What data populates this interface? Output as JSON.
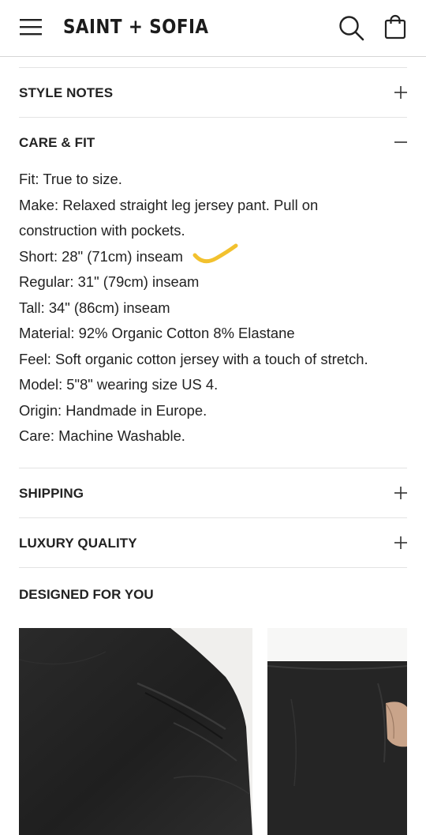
{
  "header": {
    "brand": "SAINT + SOFIA",
    "menu_icon": "hamburger-menu-icon",
    "search_icon": "search-icon",
    "bag_icon": "shopping-bag-icon"
  },
  "accordions": {
    "style_notes": {
      "label": "STYLE NOTES",
      "expanded": false
    },
    "care_fit": {
      "label": "CARE & FIT",
      "expanded": true,
      "lines": [
        "Fit: True to size.",
        "Make: Relaxed straight leg jersey pant. Pull on construction with pockets.",
        "Short: 28\" (71cm) inseam",
        "Regular: 31\" (79cm) inseam",
        "Tall: 34\" (86cm) inseam",
        "Material: 92% Organic Cotton 8% Elastane",
        "Feel: Soft organic cotton jersey with a touch of stretch.",
        "Model: 5\"8\" wearing size US 4.",
        "Origin: Handmade in Europe.",
        "Care: Machine Washable."
      ]
    },
    "shipping": {
      "label": "SHIPPING",
      "expanded": false
    },
    "luxury_quality": {
      "label": "LUXURY QUALITY",
      "expanded": false
    }
  },
  "designed_for_you": {
    "title": "DESIGNED FOR YOU",
    "products": [
      {
        "image": "black-jersey-pant-fabric-detail"
      },
      {
        "image": "black-jersey-pant-on-model"
      }
    ]
  },
  "colors": {
    "text": "#222222",
    "divider": "#e3e3e3",
    "highlight": "#f2c12e",
    "fabric": "#252525"
  }
}
